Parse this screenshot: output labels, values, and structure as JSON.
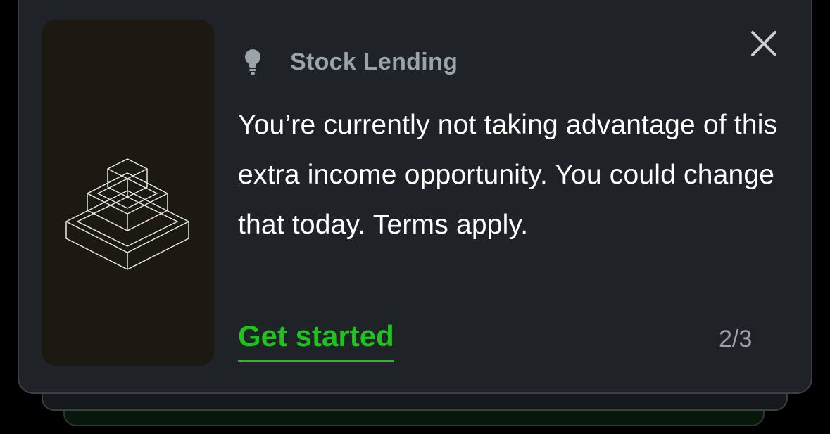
{
  "card": {
    "category": "Stock Lending",
    "message": "You’re currently not taking advantage of this extra income opportunity. You could change that today. Terms apply.",
    "cta_label": "Get started",
    "pager": "2/3"
  },
  "icons": {
    "category": "lightbulb-icon",
    "close": "close-icon",
    "illustration": "stacked-cubes-illustration"
  },
  "colors": {
    "card_background": "#1f2226",
    "cta": "#1ec31e",
    "muted_text": "#9ba3ab",
    "body_text": "#ffffff"
  }
}
